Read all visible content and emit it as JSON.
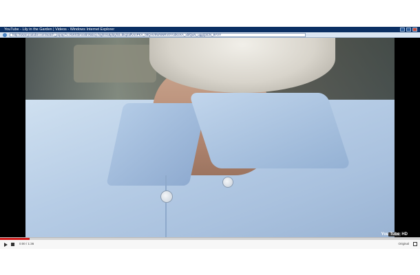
{
  "window": {
    "title": "YouTube - Lily in the Garden | Videos - Windows Internet Explorer"
  },
  "address_bar": {
    "url": "http://www.youtube.com/watch_popup?v=NWSl3mvxBnN&vq=highres&playlist=bkq2affvnnPKA_08QHV9WNNRV0YVdKeXA_xbfQuN_uggQ3CN_9YVY"
  },
  "player": {
    "progress": 0.07,
    "time": "0:00 / 1:36",
    "quality": "Original",
    "logo_text": "You",
    "logo_tube": "Tube",
    "hd_label": "HD"
  },
  "colors": {
    "progress": "#d21c1c",
    "titlebar": "#0b2f63"
  }
}
